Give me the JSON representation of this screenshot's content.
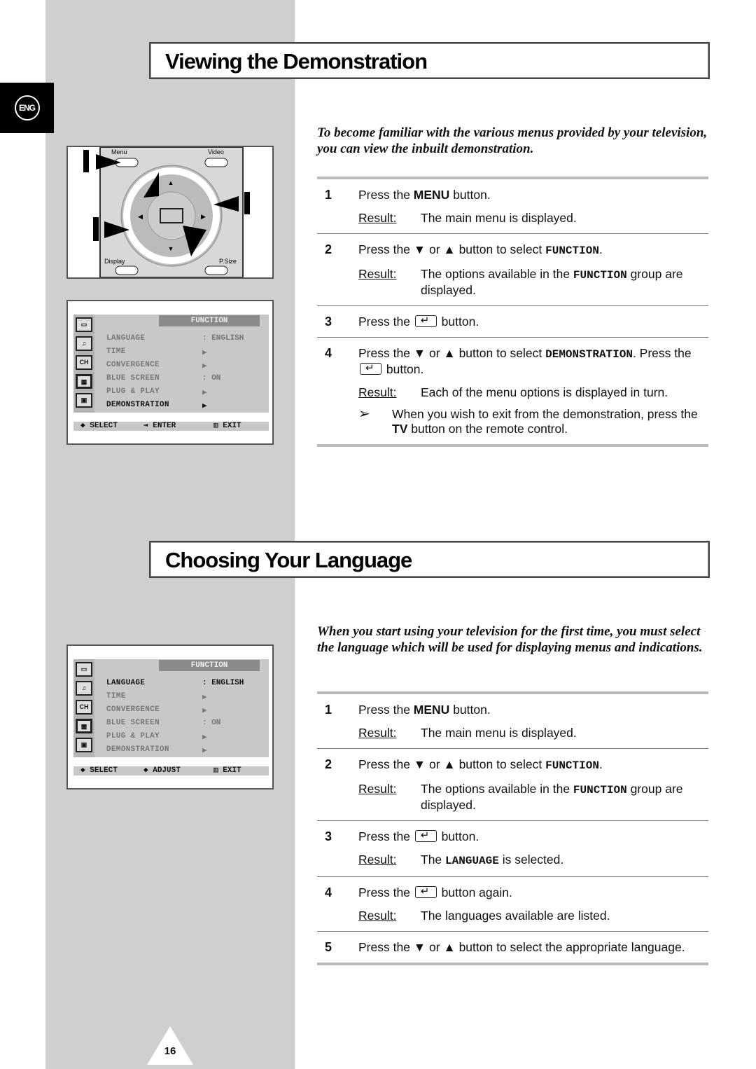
{
  "language_badge": "ENG",
  "page_number": "16",
  "sections": [
    {
      "title": "Viewing the Demonstration",
      "intro": "To become familiar with the various menus provided by your television, you can view the inbuilt demonstration.",
      "steps": [
        {
          "num": "1",
          "instr": [
            {
              "t": "Press the "
            },
            {
              "b": "MENU"
            },
            {
              "t": " button."
            }
          ],
          "result": "The main menu is displayed."
        },
        {
          "num": "2",
          "instr": [
            {
              "t": "Press the ▼ or ▲ button to select "
            },
            {
              "m": "FUNCTION"
            },
            {
              "t": "."
            }
          ],
          "result": [
            {
              "t": "The options available in the "
            },
            {
              "m": "FUNCTION"
            },
            {
              "t": " group are displayed."
            }
          ]
        },
        {
          "num": "3",
          "instr": [
            {
              "t": "Press the "
            },
            {
              "icon": "enter-icon"
            },
            {
              "t": " button."
            }
          ]
        },
        {
          "num": "4",
          "instr": [
            {
              "t": "Press the ▼ or ▲ button to select "
            },
            {
              "m": "DEMONSTRATION"
            },
            {
              "t": ". Press the "
            },
            {
              "icon": "enter-icon"
            },
            {
              "t": " button."
            }
          ],
          "result": "Each of the menu options is displayed in turn.",
          "note": [
            {
              "t": "When you wish to exit from the demonstration, press the "
            },
            {
              "b": "TV"
            },
            {
              "t": " button on the remote control."
            }
          ]
        }
      ],
      "menu": {
        "header": "FUNCTION",
        "rows": [
          {
            "label": "LANGUAGE",
            "value": ": ENGLISH"
          },
          {
            "label": "TIME",
            "value": "▶"
          },
          {
            "label": "CONVERGENCE",
            "value": "▶"
          },
          {
            "label": "BLUE SCREEN",
            "value": ": ON"
          },
          {
            "label": "PLUG & PLAY",
            "value": "▶"
          },
          {
            "label": "DEMONSTRATION",
            "value": "▶"
          }
        ],
        "selected": 5,
        "footer": [
          "◆ SELECT",
          "⇥ ENTER",
          "▥ EXIT"
        ]
      }
    },
    {
      "title": "Choosing Your Language",
      "intro": "When you start using your television for the first time, you must select the language which will be used for displaying menus and indications.",
      "steps": [
        {
          "num": "1",
          "instr": [
            {
              "t": "Press the "
            },
            {
              "b": "MENU"
            },
            {
              "t": " button."
            }
          ],
          "result": "The main menu is displayed."
        },
        {
          "num": "2",
          "instr": [
            {
              "t": "Press the ▼ or ▲ button to select "
            },
            {
              "m": "FUNCTION"
            },
            {
              "t": "."
            }
          ],
          "result": [
            {
              "t": "The options available in the "
            },
            {
              "m": "FUNCTION"
            },
            {
              "t": " group are displayed."
            }
          ]
        },
        {
          "num": "3",
          "instr": [
            {
              "t": "Press the "
            },
            {
              "icon": "enter-icon"
            },
            {
              "t": " button."
            }
          ],
          "result": [
            {
              "t": "The "
            },
            {
              "m": "LANGUAGE"
            },
            {
              "t": " is selected."
            }
          ]
        },
        {
          "num": "4",
          "instr": [
            {
              "t": "Press the "
            },
            {
              "icon": "enter-icon"
            },
            {
              "t": " button again."
            }
          ],
          "result": "The languages available are listed."
        },
        {
          "num": "5",
          "instr": [
            {
              "t": "Press the ▼ or ▲ button to select the appropriate language."
            }
          ]
        }
      ],
      "menu": {
        "header": "FUNCTION",
        "rows": [
          {
            "label": "LANGUAGE",
            "value": ": ENGLISH"
          },
          {
            "label": "TIME",
            "value": "▶"
          },
          {
            "label": "CONVERGENCE",
            "value": "▶"
          },
          {
            "label": "BLUE SCREEN",
            "value": ": ON"
          },
          {
            "label": "PLUG & PLAY",
            "value": "▶"
          },
          {
            "label": "DEMONSTRATION",
            "value": "▶"
          }
        ],
        "selected": 0,
        "footer": [
          "◆ SELECT",
          "◆ ADJUST",
          "▥ EXIT"
        ]
      }
    }
  ],
  "result_label": "Result:",
  "note_icon": "arrow-note-icon",
  "remote": {
    "menu": "Menu",
    "video": "Video",
    "display": "Display",
    "psize": "P.Size"
  },
  "menu_icons": [
    "picture-icon",
    "sound-icon",
    "CH",
    "function-icon",
    "setup-icon"
  ]
}
